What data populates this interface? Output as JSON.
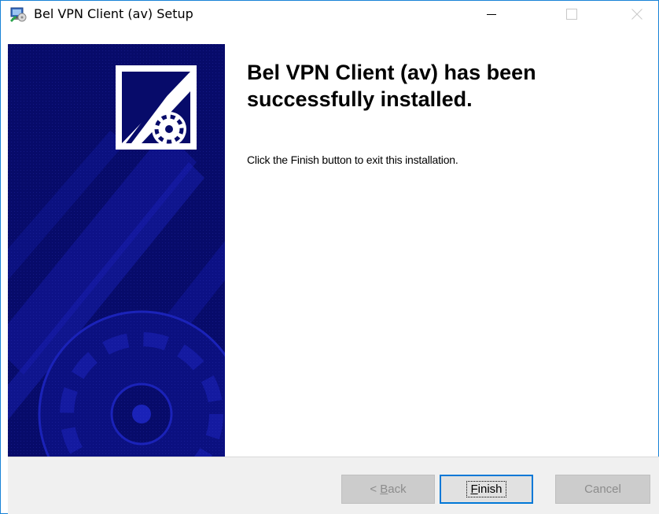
{
  "window": {
    "title": "Bel VPN Client (av) Setup",
    "icon": "setup-installer-icon",
    "controls": {
      "minimize": "minimize-icon",
      "maximize": "maximize-icon",
      "close": "close-icon"
    }
  },
  "banner": {
    "logo": "installer-disc-logo"
  },
  "content": {
    "heading": "Bel VPN Client (av) has been successfully installed.",
    "body": "Click the Finish button to exit this installation."
  },
  "buttons": {
    "back": {
      "prefix": "< ",
      "mnemonic": "B",
      "rest": "ack",
      "enabled": false
    },
    "finish": {
      "mnemonic": "F",
      "rest": "inish",
      "enabled": true
    },
    "cancel": {
      "label": "Cancel",
      "enabled": false
    }
  },
  "colors": {
    "banner": "#070b6a",
    "banner_accent": "#1a1fa0",
    "focus": "#0078d7",
    "footer": "#f0f0f0"
  }
}
